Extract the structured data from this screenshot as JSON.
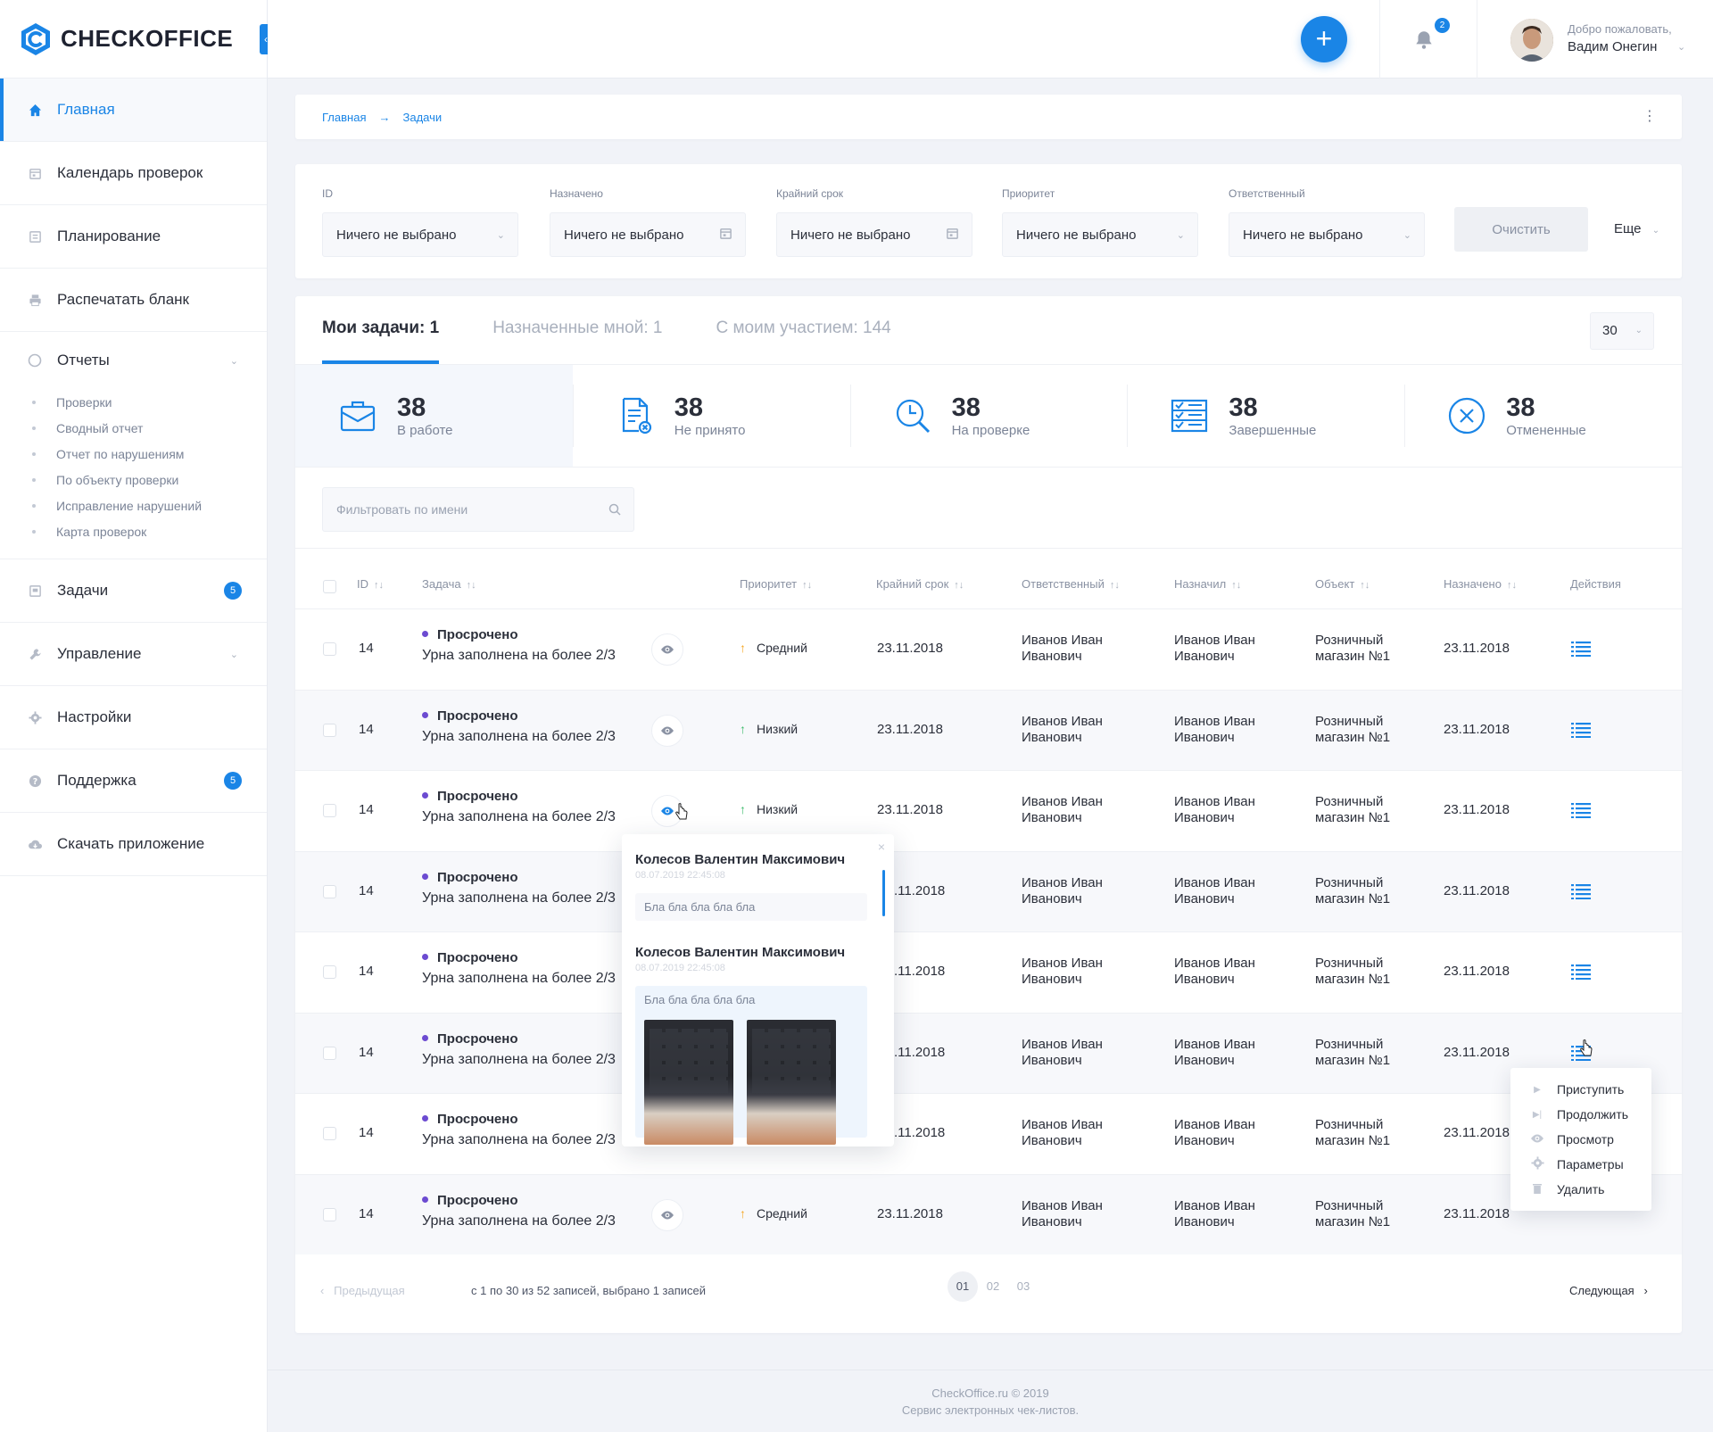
{
  "brand": {
    "name": "CHECKOFFICE"
  },
  "sidebar": {
    "items": [
      {
        "label": "Главная",
        "icon": "home-icon",
        "active": true
      },
      {
        "label": "Календарь проверок",
        "icon": "calendar-icon"
      },
      {
        "label": "Планирование",
        "icon": "planning-icon"
      },
      {
        "label": "Распечатать бланк",
        "icon": "printer-icon"
      }
    ],
    "reports": {
      "label": "Отчеты",
      "icon": "pie-chart-icon",
      "subitems": [
        "Проверки",
        "Сводный отчет",
        "Отчет по нарушениям",
        "По объекту проверки",
        "Исправление нарушений",
        "Карта проверок"
      ]
    },
    "items2": [
      {
        "label": "Задачи",
        "icon": "tasks-icon",
        "badge": "5"
      },
      {
        "label": "Управление",
        "icon": "wrench-icon"
      },
      {
        "label": "Настройки",
        "icon": "gear-icon"
      },
      {
        "label": "Поддержка",
        "icon": "help-icon",
        "badge": "5"
      },
      {
        "label": "Скачать приложение",
        "icon": "cloud-download-icon"
      }
    ]
  },
  "topbar": {
    "notifications": "2",
    "welcome": "Добро пожаловать,",
    "username": "Вадим Онегин"
  },
  "breadcrumb": {
    "home": "Главная",
    "current": "Задачи"
  },
  "filters": [
    {
      "label": "ID",
      "value": "Ничего не выбрано",
      "icon": "chevron-down-icon"
    },
    {
      "label": "Назначено",
      "value": "Ничего не выбрано",
      "icon": "calendar-icon"
    },
    {
      "label": "Крайний срок",
      "value": "Ничего не выбрано",
      "icon": "calendar-icon"
    },
    {
      "label": "Приоритет",
      "value": "Ничего не выбрано",
      "icon": "chevron-down-icon"
    },
    {
      "label": "Ответственный",
      "value": "Ничего не выбрано",
      "icon": "chevron-down-icon"
    }
  ],
  "filter_actions": {
    "clear": "Очистить",
    "more": "Еще"
  },
  "tabs": [
    "Мои задачи: 1",
    "Назначенные мной: 1",
    "С моим участием: 144"
  ],
  "page_size": "30",
  "stats": [
    {
      "value": "38",
      "label": "В работе",
      "icon": "briefcase-icon"
    },
    {
      "value": "38",
      "label": "Не принято",
      "icon": "document-rejected-icon"
    },
    {
      "value": "38",
      "label": "На проверке",
      "icon": "clock-search-icon"
    },
    {
      "value": "38",
      "label": "Завершенные",
      "icon": "checklist-icon"
    },
    {
      "value": "38",
      "label": "Отмененные",
      "icon": "cancel-circle-icon"
    }
  ],
  "search": {
    "placeholder": "Фильтровать по имени"
  },
  "table": {
    "columns": [
      "ID",
      "Задача",
      "Приоритет",
      "Крайний срок",
      "Ответственный",
      "Назначил",
      "Объект",
      "Назначено",
      "Действия"
    ],
    "rows": [
      {
        "id": "14",
        "status": "Просрочено",
        "task": "Урна заполнена на более 2/3",
        "priority": "Средний",
        "priority_color": "#f5a623",
        "deadline": "23.11.2018",
        "resp1": "Иванов Иван",
        "resp2": "Иванович",
        "by1": "Иванов Иван",
        "by2": "Иванович",
        "obj1": "Розничный",
        "obj2": "магазин №1",
        "assigned": "23.11.2018"
      },
      {
        "id": "14",
        "status": "Просрочено",
        "task": "Урна заполнена на более 2/3",
        "priority": "Низкий",
        "priority_color": "#3dbb6b",
        "deadline": "23.11.2018",
        "resp1": "Иванов Иван",
        "resp2": "Иванович",
        "by1": "Иванов Иван",
        "by2": "Иванович",
        "obj1": "Розничный",
        "obj2": "магазин №1",
        "assigned": "23.11.2018"
      },
      {
        "id": "14",
        "status": "Просрочено",
        "task": "Урна заполнена на более 2/3",
        "priority": "Низкий",
        "priority_color": "#3dbb6b",
        "deadline": "23.11.2018",
        "resp1": "Иванов Иван",
        "resp2": "Иванович",
        "by1": "Иванов Иван",
        "by2": "Иванович",
        "obj1": "Розничный",
        "obj2": "магазин №1",
        "assigned": "23.11.2018"
      },
      {
        "id": "14",
        "status": "Просрочено",
        "task": "Урна заполнена на более 2/3",
        "priority": "",
        "priority_color": "",
        "deadline": ".11.2018",
        "resp1": "Иванов Иван",
        "resp2": "Иванович",
        "by1": "Иванов Иван",
        "by2": "Иванович",
        "obj1": "Розничный",
        "obj2": "магазин №1",
        "assigned": "23.11.2018"
      },
      {
        "id": "14",
        "status": "Просрочено",
        "task": "Урна заполнена на более 2/3",
        "priority": "",
        "priority_color": "",
        "deadline": ".11.2018",
        "resp1": "Иванов Иван",
        "resp2": "Иванович",
        "by1": "Иванов Иван",
        "by2": "Иванович",
        "obj1": "Розничный",
        "obj2": "магазин №1",
        "assigned": "23.11.2018"
      },
      {
        "id": "14",
        "status": "Просрочено",
        "task": "Урна заполнена на более 2/3",
        "priority": "",
        "priority_color": "",
        "deadline": ".11.2018",
        "resp1": "Иванов Иван",
        "resp2": "Иванович",
        "by1": "Иванов Иван",
        "by2": "Иванович",
        "obj1": "Розничный",
        "obj2": "магазин №1",
        "assigned": "23.11.2018"
      },
      {
        "id": "14",
        "status": "Просрочено",
        "task": "Урна заполнена на более 2/3",
        "priority": "",
        "priority_color": "",
        "deadline": ".11.2018",
        "resp1": "Иванов Иван",
        "resp2": "Иванович",
        "by1": "Иванов Иван",
        "by2": "Иванович",
        "obj1": "Розничный",
        "obj2": "магазин №1",
        "assigned": "23.11.2018"
      },
      {
        "id": "14",
        "status": "Просрочено",
        "task": "Урна заполнена на более 2/3",
        "priority": "Средний",
        "priority_color": "#f5a623",
        "deadline": "23.11.2018",
        "resp1": "Иванов Иван",
        "resp2": "Иванович",
        "by1": "Иванов Иван",
        "by2": "Иванович",
        "obj1": "Розничный",
        "obj2": "магазин №1",
        "assigned": "23.11.2018"
      }
    ]
  },
  "comments": [
    {
      "author": "Колесов Валентин Максимович",
      "date": "08.07.2019 22:45:08",
      "text": "Бла бла бла бла бла"
    },
    {
      "author": "Колесов Валентин Максимович",
      "date": "08.07.2019 22:45:08",
      "text": "Бла бла бла бла бла"
    }
  ],
  "action_menu": [
    {
      "label": "Приступить",
      "icon": "play-icon"
    },
    {
      "label": "Продолжить",
      "icon": "skip-icon"
    },
    {
      "label": "Просмотр",
      "icon": "eye-icon"
    },
    {
      "label": "Параметры",
      "icon": "gear-icon"
    },
    {
      "label": "Удалить",
      "icon": "trash-icon"
    }
  ],
  "pagination": {
    "prev": "Предыдущая",
    "records": "с 1 по 30 из 52 записей, выбрано 1 записей",
    "pages": [
      "01",
      "02",
      "03"
    ],
    "next": "Следующая"
  },
  "footer": {
    "line1": "CheckOffice.ru © 2019",
    "line2": "Сервис электронных чек-листов."
  },
  "colors": {
    "accent": "#1a85e6",
    "status_dot": "#6c4bd1"
  }
}
